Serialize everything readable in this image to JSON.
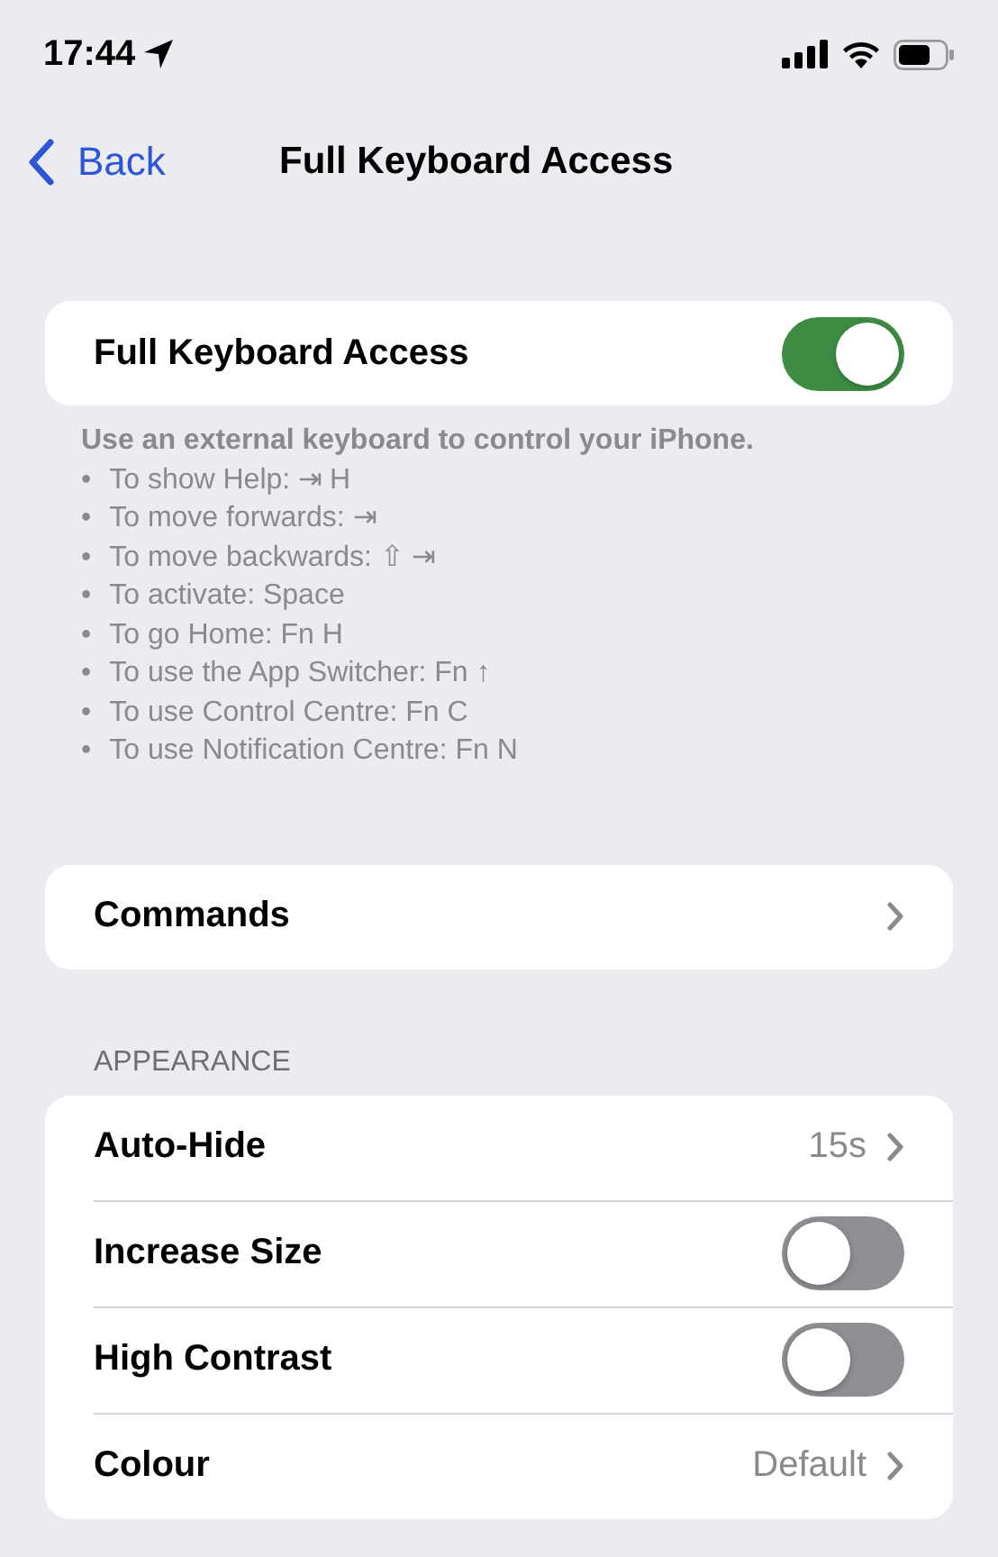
{
  "status_bar": {
    "time": "17:44"
  },
  "nav": {
    "back": "Back",
    "title": "Full Keyboard Access"
  },
  "sections": [
    {
      "rows": [
        {
          "kind": "toggle",
          "label": "Full Keyboard Access",
          "on": true
        }
      ],
      "footer": {
        "intro": "Use an external keyboard to control your iPhone.",
        "items": [
          {
            "bullet": "•",
            "text": "To show Help: ⇥ H"
          },
          {
            "bullet": "•",
            "text": "To move forwards: ⇥"
          },
          {
            "bullet": "•",
            "text": "To move backwards: ⇧ ⇥"
          },
          {
            "bullet": "•",
            "text": "To activate: Space"
          },
          {
            "bullet": "•",
            "text": "To go Home: Fn H"
          },
          {
            "bullet": "•",
            "text": "To use the App Switcher: Fn ↑"
          },
          {
            "bullet": "•",
            "text": "To use Control Centre: Fn C"
          },
          {
            "bullet": "•",
            "text": "To use Notification Centre: Fn N"
          }
        ]
      }
    },
    {
      "rows": [
        {
          "kind": "link",
          "label": "Commands"
        }
      ]
    },
    {
      "header": "APPEARANCE",
      "rows": [
        {
          "kind": "link",
          "label": "Auto-Hide",
          "value": "15s"
        },
        {
          "kind": "toggle",
          "label": "Increase Size",
          "on": false
        },
        {
          "kind": "toggle",
          "label": "High Contrast",
          "on": false
        },
        {
          "kind": "link",
          "label": "Colour",
          "value": "Default"
        }
      ]
    }
  ]
}
